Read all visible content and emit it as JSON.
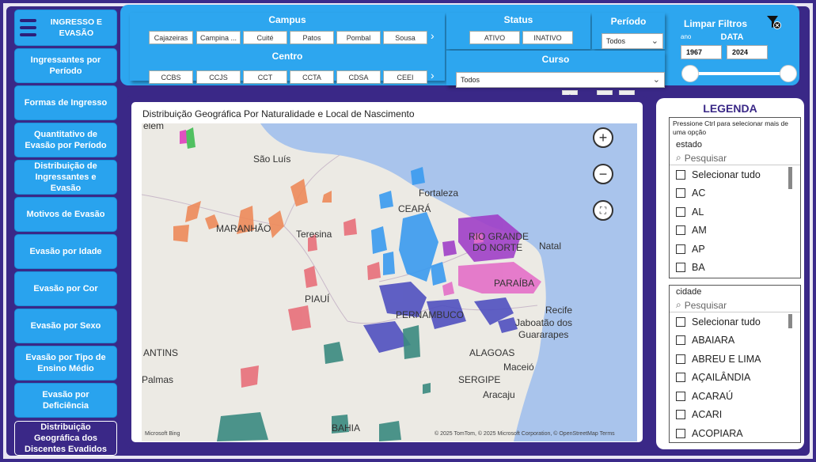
{
  "sidebar": {
    "header": "INGRESSO E EVASÃO",
    "items": [
      {
        "label": "Ingressantes por Período"
      },
      {
        "label": "Formas de Ingresso"
      },
      {
        "label": "Quantitativo de Evasão por Período"
      },
      {
        "label": "Distribuição de Ingressantes e Evasão"
      },
      {
        "label": "Motivos de Evasão"
      },
      {
        "label": "Evasão por Idade"
      },
      {
        "label": "Evasão por Cor"
      },
      {
        "label": "Evasão por Sexo"
      },
      {
        "label": "Evasão por Tipo de Ensino Médio"
      },
      {
        "label": "Evasão por Deficiência"
      },
      {
        "label": "Distribuição Geográfica dos Discentes Evadidos"
      }
    ]
  },
  "filters": {
    "campus": {
      "title": "Campus",
      "chips": [
        "Cajazeiras",
        "Campina ...",
        "Cuité",
        "Patos",
        "Pombal",
        "Sousa"
      ]
    },
    "centro": {
      "title": "Centro",
      "chips": [
        "CCBS",
        "CCJS",
        "CCT",
        "CCTA",
        "CDSA",
        "CEEI"
      ]
    },
    "status": {
      "title": "Status",
      "chips": [
        "ATIVO",
        "INATIVO"
      ]
    },
    "periodo": {
      "title": "Período",
      "value": "Todos"
    },
    "curso": {
      "title": "Curso",
      "value": "Todos"
    },
    "limpar": {
      "title": "Limpar Filtros"
    },
    "data": {
      "ano_label": "ano",
      "title": "DATA",
      "start": "1967",
      "end": "2024",
      "range_fraction": [
        0.0,
        1.0
      ]
    }
  },
  "map": {
    "title": "Distribuição Geográfica Por Naturalidade e Local de Nascimento",
    "labels": [
      "elem",
      "São Luís",
      "Fortaleza",
      "CEARÁ",
      "MARANHÃO",
      "Teresina",
      "RIO GRANDE",
      "DO NORTE",
      "Natal",
      "PARAÍBA",
      "PIAUÍ",
      "PERNAMBUCO",
      "Recife",
      "Jaboatão dos",
      "Guararapes",
      "ALAGOAS",
      "Maceió",
      "SERGIPE",
      "Aracaju",
      "ANTINS",
      "Palmas",
      "BAHIA"
    ],
    "attribution": "© 2025 TomTom, © 2025 Microsoft Corporation, © OpenStreetMap  Terms",
    "brand": "Microsoft Bing",
    "colors": {
      "sea": "#a9c4ec",
      "land": "#eceae4",
      "ceara": "#3a9bf0",
      "rn": "#a040c8",
      "pb": "#e46fc8",
      "pe": "#5050c0",
      "pi": "#e8707a",
      "ma": "#ee8a5a",
      "ba": "#3a8a80"
    }
  },
  "legend": {
    "title": "LEGENDA",
    "estado": {
      "hint": "Pressione Ctrl para selecionar mais de uma opção",
      "label": "estado",
      "search": "Pesquisar",
      "options": [
        "Selecionar tudo",
        "AC",
        "AL",
        "AM",
        "AP",
        "BA"
      ]
    },
    "cidade": {
      "label": "cidade",
      "search": "Pesquisar",
      "options": [
        "Selecionar tudo",
        "ABAIARA",
        "ABREU E LIMA",
        "AÇAILÂNDIA",
        "ACARAÚ",
        "ACARI",
        "ACOPIARA"
      ]
    }
  }
}
